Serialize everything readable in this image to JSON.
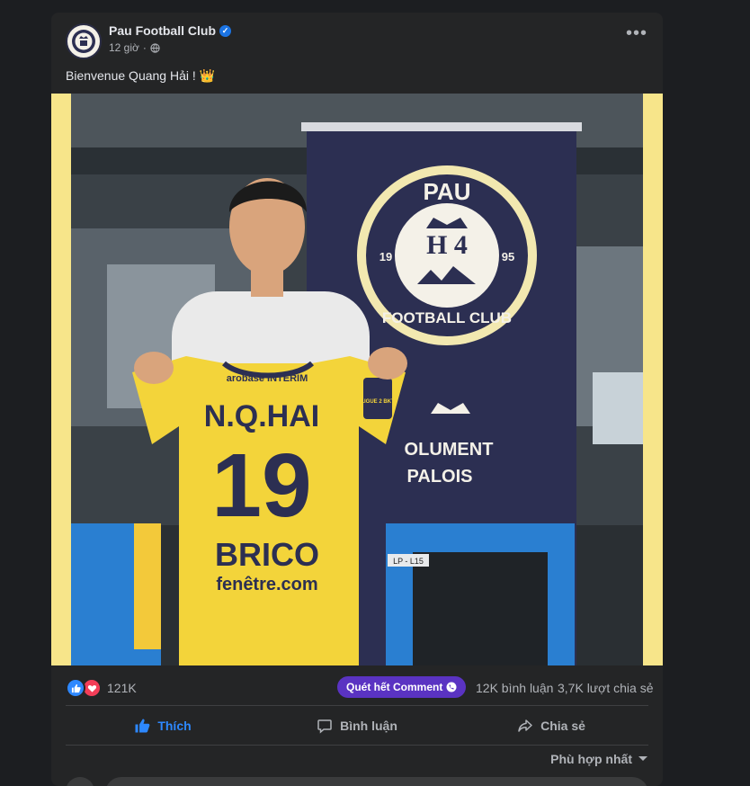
{
  "post": {
    "page_name": "Pau Football Club",
    "time": "12 giờ",
    "privacy_icon": "globe-icon",
    "caption": "Bienvenue Quang Hải ! 👑"
  },
  "photo": {
    "banner_text_1": "PAU",
    "banner_text_2": "FOOTBALL CLUB",
    "banner_year_left": "19",
    "banner_year_right": "95",
    "banner_letters": "H 4",
    "banner_slogan_1": "OLUMENT",
    "banner_slogan_2": "PALOIS",
    "shirt_sponsor_top": "arobase INTERIM",
    "shirt_name": "N.Q.HAI",
    "shirt_number": "19",
    "shirt_sponsor_main": "BRICO",
    "shirt_sponsor_sub": "fenêtre.com",
    "shirt_badge": "LIGUE 2 BKT",
    "seat_tag": "LP - L15",
    "colors": {
      "background": "#f7e58a",
      "shirt": "#f3d43a",
      "banner": "#2c2f52"
    }
  },
  "stats": {
    "reactions_count": "121K",
    "promo_label": "Quét hết Comment",
    "comments": "12K bình luận",
    "shares": "3,7K lượt chia sẻ"
  },
  "actions": {
    "like": "Thích",
    "comment": "Bình luận",
    "share": "Chia sẻ"
  },
  "sort_label": "Phù hợp nhất"
}
